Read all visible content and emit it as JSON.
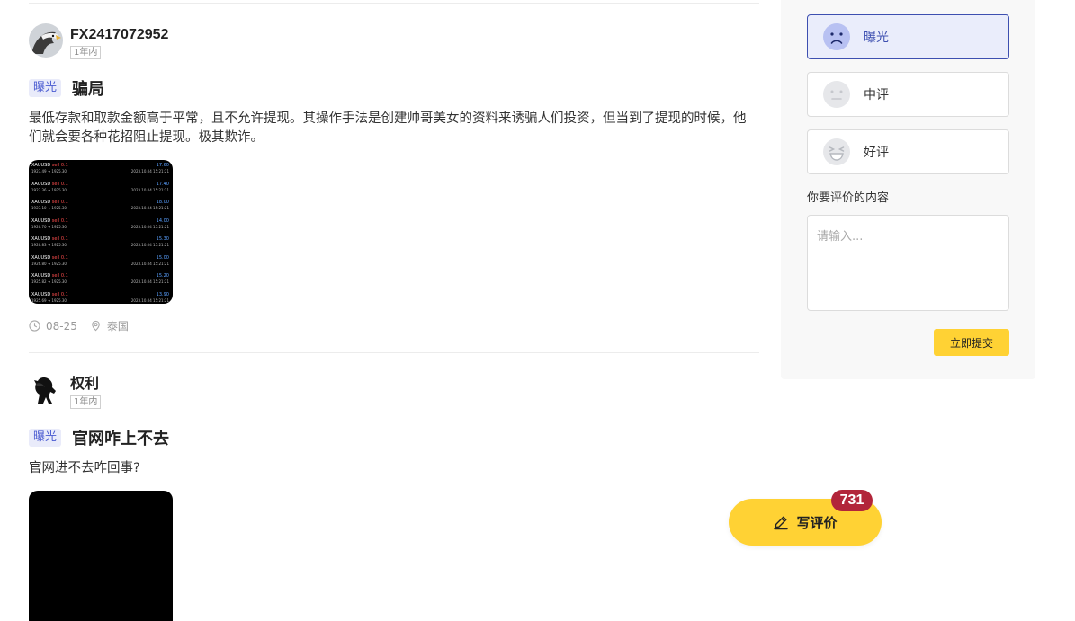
{
  "posts": [
    {
      "author": "FX2417072952",
      "tenure": "1年内",
      "tag": "曝光",
      "title": "骗局",
      "body": "最低存款和取款金额高于平常，且不允许提现。其操作手法是创建帅哥美女的资料来诱骗人们投资，但当到了提现的时候，他们就会要各种花招阻止提现。极其欺诈。",
      "date": "08-25",
      "location": "泰国"
    },
    {
      "author": "权利",
      "tenure": "1年内",
      "tag": "曝光",
      "title": "官网咋上不去",
      "body": "官网进不去咋回事?"
    }
  ],
  "trade_rows": [
    {
      "symbol": "XAUUSD",
      "side": "sell 0.1",
      "detail": "1927.49 → 1925.30",
      "time": "2023.10.04 15:21:21",
      "value": "17.60"
    },
    {
      "symbol": "XAUUSD",
      "side": "sell 0.1",
      "detail": "1927.36 → 1925.30",
      "time": "2023.10.04 15:21:21",
      "value": "17.40"
    },
    {
      "symbol": "XAUUSD",
      "side": "sell 0.1",
      "detail": "1927.10 → 1925.30",
      "time": "2023.10.04 15:21:21",
      "value": "18.00"
    },
    {
      "symbol": "XAUUSD",
      "side": "sell 0.1",
      "detail": "1926.70 → 1925.30",
      "time": "2023.10.04 15:21:21",
      "value": "14.00"
    },
    {
      "symbol": "XAUUSD",
      "side": "sell 0.1",
      "detail": "1926.83 → 1925.30",
      "time": "2023.10.04 15:21:21",
      "value": "15.30"
    },
    {
      "symbol": "XAUUSD",
      "side": "sell 0.1",
      "detail": "1926.80 → 1925.30",
      "time": "2023.10.04 15:21:21",
      "value": "15.00"
    },
    {
      "symbol": "XAUUSD",
      "side": "sell 0.1",
      "detail": "1925.82 → 1925.30",
      "time": "2023.10.04 15:21:21",
      "value": "15.20"
    },
    {
      "symbol": "XAUUSD",
      "side": "sell 0.1",
      "detail": "1925.69 → 1925.30",
      "time": "2023.10.04 15:21:21",
      "value": "13.90"
    }
  ],
  "rating": {
    "options": [
      {
        "label": "曝光",
        "icon": "sad-face-icon",
        "selected": true
      },
      {
        "label": "中评",
        "icon": "neutral-face-icon",
        "selected": false
      },
      {
        "label": "好评",
        "icon": "laughing-face-icon",
        "selected": false
      }
    ],
    "content_label": "你要评价的内容",
    "placeholder": "请输入...",
    "submit_label": "立即提交"
  },
  "write_review": {
    "label": "写评价",
    "count": "731"
  },
  "colors": {
    "accent_yellow": "#ffd234",
    "tag_blue": "#4a5bd1",
    "badge_red": "#b2253a"
  }
}
